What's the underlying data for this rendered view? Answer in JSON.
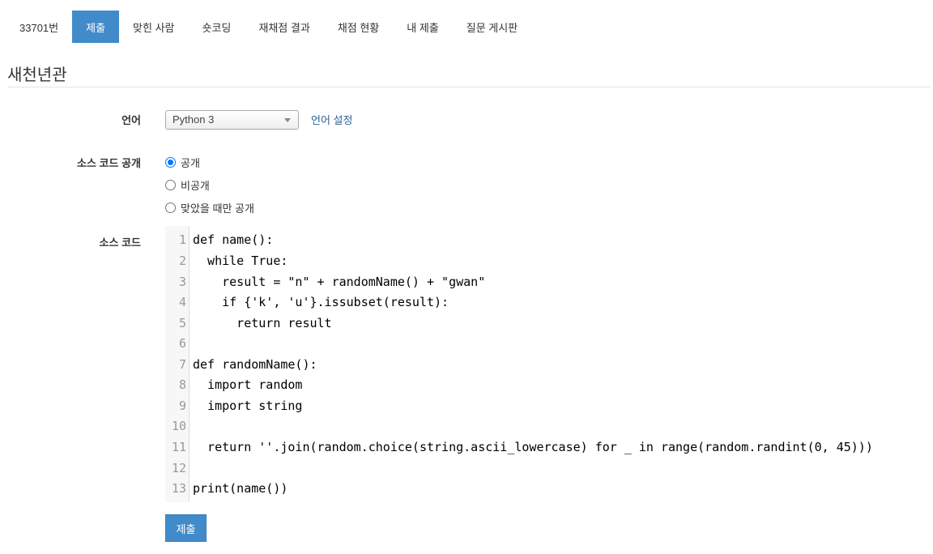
{
  "tabs": [
    {
      "label": "33701번",
      "active": false
    },
    {
      "label": "제출",
      "active": true
    },
    {
      "label": "맞힌 사람",
      "active": false
    },
    {
      "label": "숏코딩",
      "active": false
    },
    {
      "label": "재채점 결과",
      "active": false
    },
    {
      "label": "채점 현황",
      "active": false
    },
    {
      "label": "내 제출",
      "active": false
    },
    {
      "label": "질문 게시판",
      "active": false
    }
  ],
  "page_title": "새천년관",
  "form": {
    "language_label": "언어",
    "language_value": "Python 3",
    "language_settings_link": "언어 설정",
    "visibility_label": "소스 코드 공개",
    "visibility_options": [
      {
        "label": "공개",
        "checked": true
      },
      {
        "label": "비공개",
        "checked": false
      },
      {
        "label": "맞았을 때만 공개",
        "checked": false
      }
    ],
    "source_label": "소스 코드",
    "submit_label": "제출"
  },
  "editor": {
    "lines": [
      "def name():",
      "  while True:",
      "    result = \"n\" + randomName() + \"gwan\"",
      "    if {'k', 'u'}.issubset(result):",
      "      return result",
      "",
      "def randomName():",
      "  import random",
      "  import string",
      "",
      "  return ''.join(random.choice(string.ascii_lowercase) for _ in range(random.randint(0, 45)))",
      "",
      "print(name())"
    ]
  },
  "colors": {
    "accent": "#428bca",
    "link": "#2a6496"
  }
}
